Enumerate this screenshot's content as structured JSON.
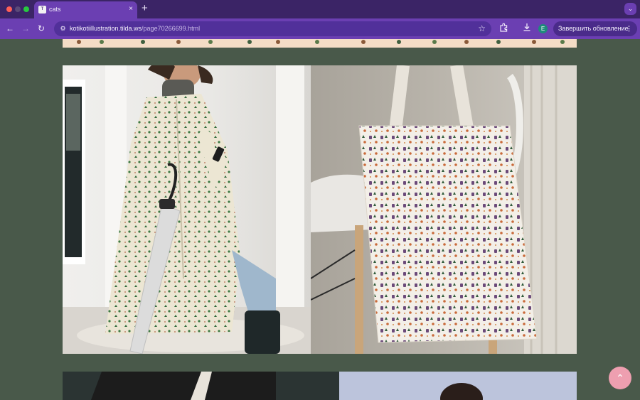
{
  "tabs": [
    {
      "title": "cats",
      "favicon": "tilda-favicon",
      "active": true
    }
  ],
  "tab_close_glyph": "×",
  "new_tab_glyph": "+",
  "address_bar": {
    "domain": "kotikotiillustration.tilda.ws",
    "path": "/page70266699.html"
  },
  "profile_initial": "E",
  "update_button": {
    "label": "Завершить обновление"
  },
  "theme": {
    "tabbar": "#3b2466",
    "toolbar": "#6b3fb2",
    "page_background": "#49594a",
    "scroll_top_button": "#ee9fb0"
  },
  "content": {
    "images": [
      {
        "name": "woman-in-patterned-raincoat-photo"
      },
      {
        "name": "patterned-tote-bag-photo"
      },
      {
        "name": "bottom-left-photo"
      },
      {
        "name": "bottom-right-photo"
      }
    ]
  }
}
